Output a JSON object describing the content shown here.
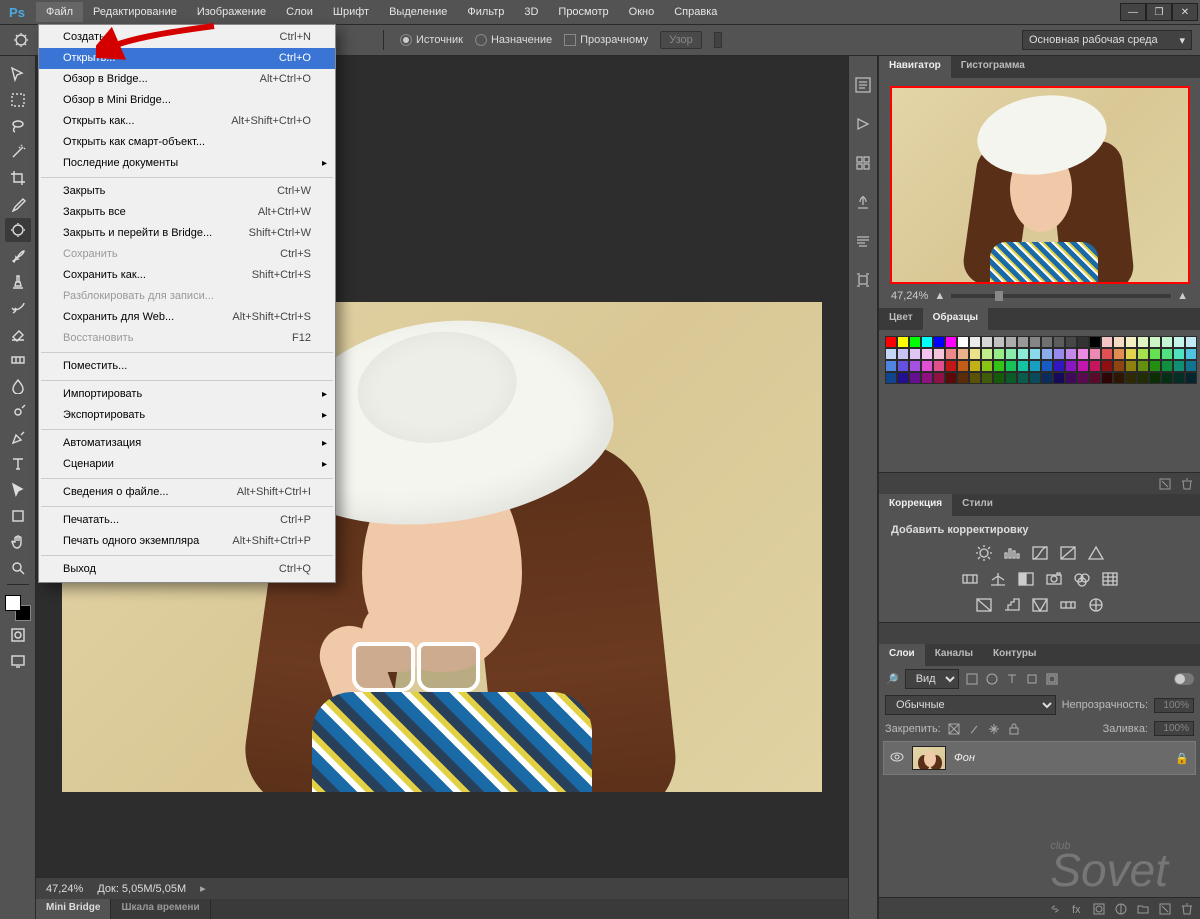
{
  "app": {
    "logo": "Ps"
  },
  "menu": {
    "items": [
      "Файл",
      "Редактирование",
      "Изображение",
      "Слои",
      "Шрифт",
      "Выделение",
      "Фильтр",
      "3D",
      "Просмотр",
      "Окно",
      "Справка"
    ]
  },
  "options": {
    "source_label": "Источник",
    "dest_label": "Назначение",
    "transparent_label": "Прозрачному",
    "pattern_btn": "Узор",
    "workspace": "Основная рабочая среда"
  },
  "dropdown": {
    "items": [
      {
        "label": "Создать...",
        "shortcut": "Ctrl+N"
      },
      {
        "label": "Открыть...",
        "shortcut": "Ctrl+O",
        "highlight": true
      },
      {
        "label": "Обзор в Bridge...",
        "shortcut": "Alt+Ctrl+O"
      },
      {
        "label": "Обзор в Mini Bridge..."
      },
      {
        "label": "Открыть как...",
        "shortcut": "Alt+Shift+Ctrl+O"
      },
      {
        "label": "Открыть как смарт-объект..."
      },
      {
        "label": "Последние документы",
        "sub": true
      },
      {
        "sep": true
      },
      {
        "label": "Закрыть",
        "shortcut": "Ctrl+W"
      },
      {
        "label": "Закрыть все",
        "shortcut": "Alt+Ctrl+W"
      },
      {
        "label": "Закрыть и перейти в Bridge...",
        "shortcut": "Shift+Ctrl+W"
      },
      {
        "label": "Сохранить",
        "shortcut": "Ctrl+S",
        "disabled": true
      },
      {
        "label": "Сохранить как...",
        "shortcut": "Shift+Ctrl+S"
      },
      {
        "label": "Разблокировать для записи...",
        "disabled": true
      },
      {
        "label": "Сохранить для Web...",
        "shortcut": "Alt+Shift+Ctrl+S"
      },
      {
        "label": "Восстановить",
        "shortcut": "F12",
        "disabled": true
      },
      {
        "sep": true
      },
      {
        "label": "Поместить..."
      },
      {
        "sep": true
      },
      {
        "label": "Импортировать",
        "sub": true
      },
      {
        "label": "Экспортировать",
        "sub": true
      },
      {
        "sep": true
      },
      {
        "label": "Автоматизация",
        "sub": true
      },
      {
        "label": "Сценарии",
        "sub": true
      },
      {
        "sep": true
      },
      {
        "label": "Сведения о файле...",
        "shortcut": "Alt+Shift+Ctrl+I"
      },
      {
        "sep": true
      },
      {
        "label": "Печатать...",
        "shortcut": "Ctrl+P"
      },
      {
        "label": "Печать одного экземпляра",
        "shortcut": "Alt+Shift+Ctrl+P"
      },
      {
        "sep": true
      },
      {
        "label": "Выход",
        "shortcut": "Ctrl+Q"
      }
    ]
  },
  "status": {
    "zoom": "47,24%",
    "doc": "Док:  5,05M/5,05M"
  },
  "bottom_tabs": [
    "Mini Bridge",
    "Шкала времени"
  ],
  "panels": {
    "navigator": {
      "tabs": [
        "Навигатор",
        "Гистограмма"
      ],
      "zoom": "47,24%"
    },
    "color": {
      "tabs": [
        "Цвет",
        "Образцы"
      ]
    },
    "adjust": {
      "tabs": [
        "Коррекция",
        "Стили"
      ],
      "label": "Добавить корректировку"
    },
    "layers": {
      "tabs": [
        "Слои",
        "Каналы",
        "Контуры"
      ],
      "kind_label": "Вид",
      "blend": "Обычные",
      "opacity_label": "Непрозрачность:",
      "opacity_value": "100%",
      "lock_label": "Закрепить:",
      "fill_label": "Заливка:",
      "fill_value": "100%",
      "layer_name": "Фон"
    }
  },
  "watermark": {
    "line1": "club",
    "line2": "Sovet"
  },
  "swatch_colors": [
    "#ff0000",
    "#ffff00",
    "#00ff00",
    "#00ffff",
    "#0000ff",
    "#ff00ff",
    "#ffffff",
    "#ebebeb",
    "#d6d6d6",
    "#c2c2c2",
    "#adadad",
    "#999999",
    "#858585",
    "#707070",
    "#5c5c5c",
    "#474747",
    "#333333",
    "#000000",
    "#f5c4c4",
    "#f5dac4",
    "#f5f0c4",
    "#e0f5c4",
    "#caf5c4",
    "#c4f5d4",
    "#c4f5ea",
    "#c4ebf5",
    "#c4d5f5",
    "#cac4f5",
    "#e0c4f5",
    "#f5c4f0",
    "#f5c4da",
    "#ec8a8a",
    "#ecb38a",
    "#ece18a",
    "#c3ec8a",
    "#97ec8a",
    "#8aecab",
    "#8aecd6",
    "#8ad8ec",
    "#8aadec",
    "#978aec",
    "#c38aec",
    "#ec8ae1",
    "#ec8ab3",
    "#e15050",
    "#e18c50",
    "#e1d250",
    "#a6e150",
    "#64e150",
    "#50e181",
    "#50e1c1",
    "#50c3e1",
    "#5085e1",
    "#6450e1",
    "#a650e1",
    "#e150d2",
    "#e1508c",
    "#c31616",
    "#c35c16",
    "#c3b016",
    "#89c316",
    "#31c316",
    "#16c357",
    "#16c3a0",
    "#169fc3",
    "#165dc3",
    "#3116c3",
    "#8916c3",
    "#c316b0",
    "#c3165c",
    "#8f1010",
    "#8f4310",
    "#8f8010",
    "#648f10",
    "#238f10",
    "#108f3f",
    "#108f75",
    "#10748f",
    "#10448f",
    "#23108f",
    "#64108f",
    "#8f1080",
    "#8f1043",
    "#5b0a0a",
    "#5b2b0a",
    "#5b520a",
    "#405b0a",
    "#175b0a",
    "#0a5b28",
    "#0a5b4b",
    "#0a4a5b",
    "#0a2b5b",
    "#170a5b",
    "#400a5b",
    "#5b0a52",
    "#5b0a2b",
    "#2e0505",
    "#2e1605",
    "#2e2a05",
    "#212e05",
    "#0c2e05",
    "#052e14",
    "#052e26",
    "#05262e"
  ]
}
